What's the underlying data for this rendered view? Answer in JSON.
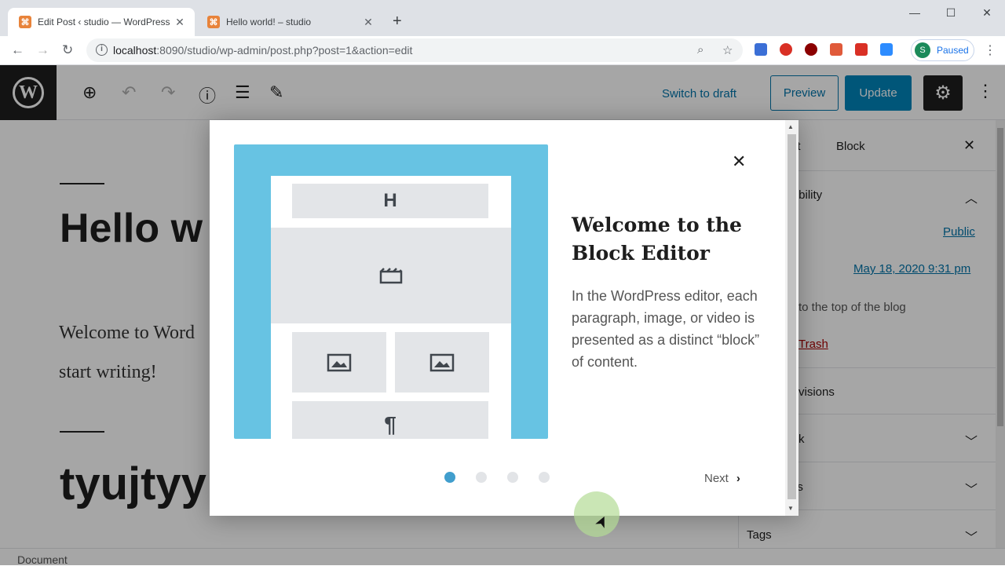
{
  "browser": {
    "tabs": [
      {
        "title": "Edit Post ‹ studio — WordPress",
        "active": true
      },
      {
        "title": "Hello world! – studio",
        "active": false
      }
    ],
    "url_host": "localhost",
    "url_rest": ":8090/studio/wp-admin/post.php?post=1&action=edit",
    "profile_initial": "S",
    "profile_status": "Paused"
  },
  "editor": {
    "switch_to_draft": "Switch to draft",
    "preview": "Preview",
    "update": "Update",
    "post_title": "Hello w",
    "paragraph_line1": "Welcome to Word",
    "paragraph_line2": "start writing!",
    "heading": "tyujtyy",
    "status_bar": "Document"
  },
  "sidebar": {
    "tab_document": "nt",
    "tab_block": "Block",
    "visibility_title": "isibility",
    "visibility_value": "Public",
    "publish_value": "May 18, 2020 9:31 pm",
    "stick_text": "to the top of the blog",
    "trash": "Trash",
    "revisions": "visions",
    "section_a": "k",
    "section_b": "es",
    "tags": "Tags"
  },
  "guide": {
    "title": "Welcome to the Block Editor",
    "body": "In the WordPress editor, each paragraph, image, or video is presented as a distinct “block” of content.",
    "next": "Next",
    "page_count": 4,
    "current_page": 1,
    "illustration_blocks": {
      "heading": "H",
      "paragraph": "¶"
    }
  },
  "colors": {
    "wp_blue": "#0073aa",
    "update_blue": "#0085ba",
    "illus_bg": "#67c3e3",
    "dot_active": "#419ecd"
  }
}
